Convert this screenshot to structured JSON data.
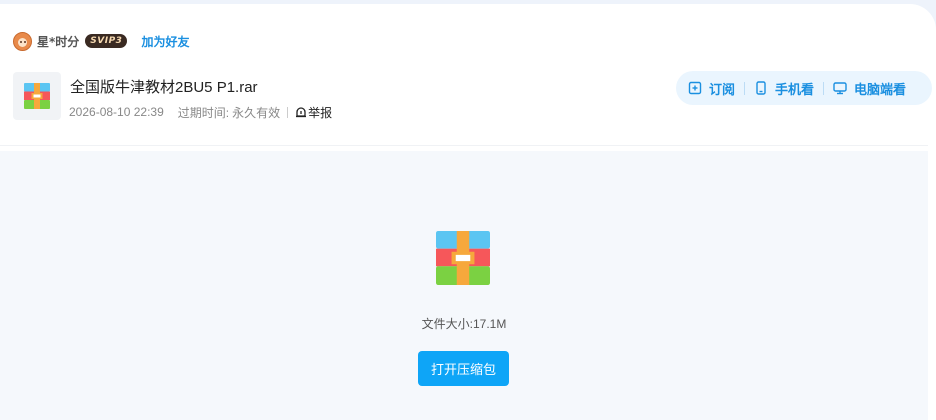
{
  "user": {
    "name": "星*时分",
    "vip_badge": "SVIP3",
    "add_friend_label": "加为好友"
  },
  "file": {
    "title": "全国版牛津教材2BU5 P1.rar",
    "date": "2026-08-10 22:39",
    "expire_label": "过期时间:",
    "expire_value": "永久有效",
    "report_label": "举报",
    "icon": "rar-archive-icon"
  },
  "actions": {
    "subscribe_label": "订阅",
    "phone_label": "手机看",
    "pc_label": "电脑端看"
  },
  "preview": {
    "size_text": "文件大小:17.1M",
    "open_button_label": "打开压缩包"
  },
  "colors": {
    "accent": "#1a8fe0",
    "button": "#0ea5f7",
    "pill_bg": "#eaf5fe",
    "preview_bg": "#f5f8fc"
  }
}
